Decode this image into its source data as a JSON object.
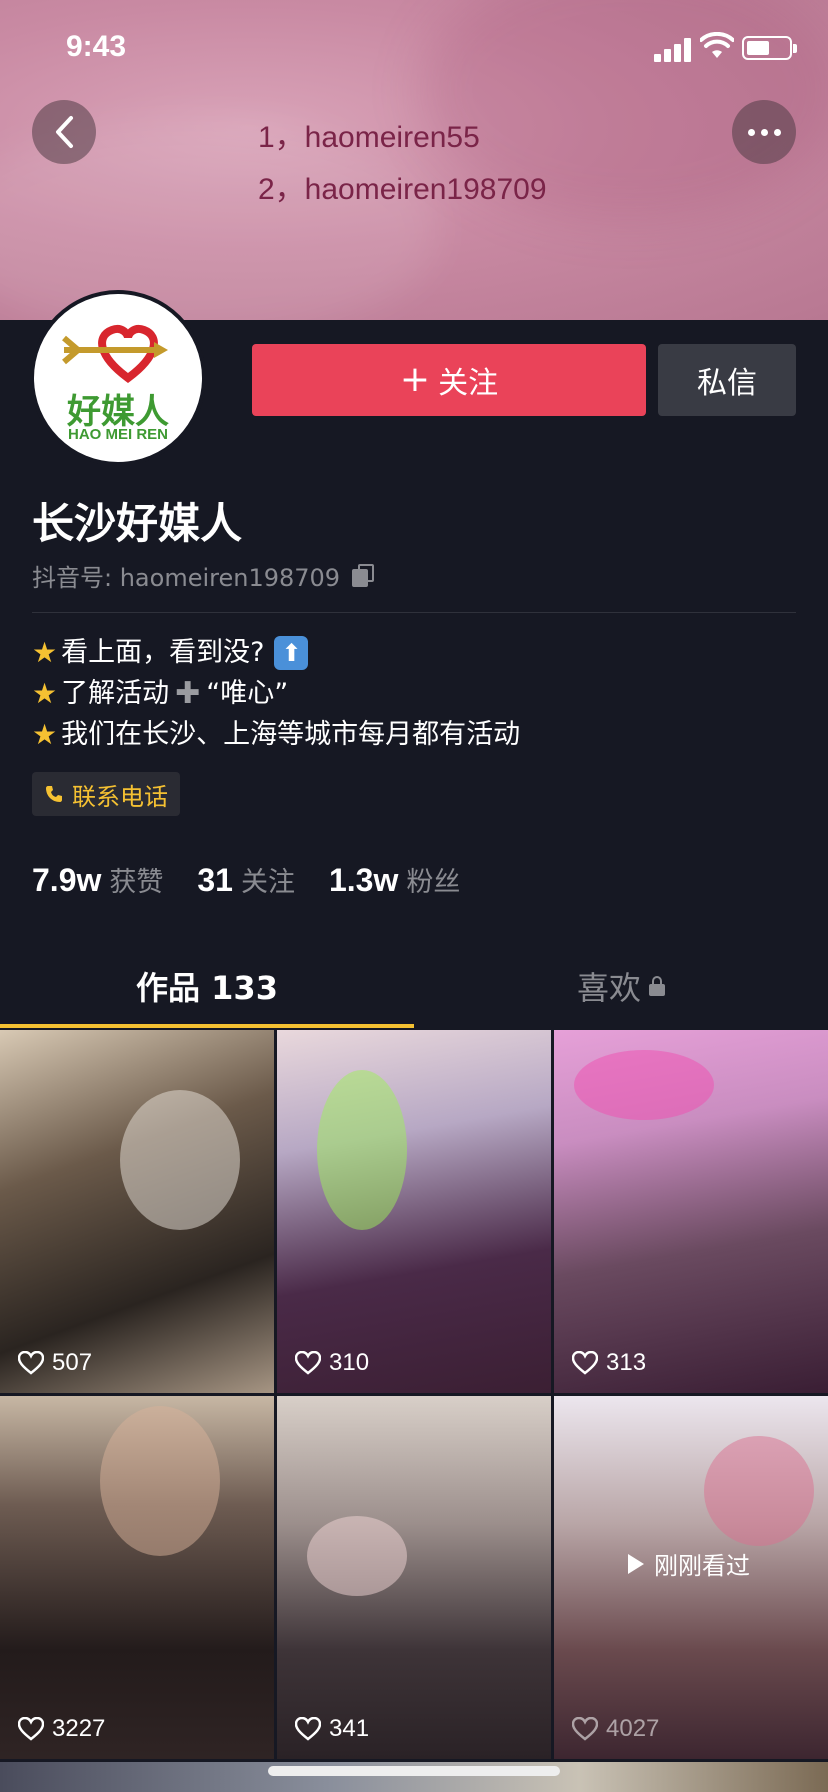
{
  "status": {
    "time": "9:43"
  },
  "banner": {
    "lines": [
      "1，haomeiren55",
      "2，haomeiren198709"
    ]
  },
  "avatar": {
    "logo_text": "好媒人",
    "logo_sub": "HAO MEI REN"
  },
  "actions": {
    "follow_label": "关注",
    "message_label": "私信"
  },
  "profile": {
    "name": "长沙好媒人",
    "douyin_id": "抖音号: haomeiren198709",
    "bio": [
      "看上面，看到没?",
      "了解活动",
      "“唯心”",
      "我们在长沙、上海等城市每月都有活动"
    ],
    "contact_label": "联系电话"
  },
  "stats": [
    {
      "num": "7.9w",
      "label": "获赞"
    },
    {
      "num": "31",
      "label": "关注"
    },
    {
      "num": "1.3w",
      "label": "粉丝"
    }
  ],
  "tabs": {
    "works": "作品 133",
    "likes": "喜欢"
  },
  "videos": [
    {
      "likes": "507"
    },
    {
      "likes": "310"
    },
    {
      "likes": "313"
    },
    {
      "likes": "3227"
    },
    {
      "likes": "341"
    },
    {
      "likes": "4027",
      "watched_label": "刚刚看过"
    }
  ],
  "colors": {
    "follow": "#ea4359",
    "accent": "#f5c132",
    "background": "#161823"
  }
}
